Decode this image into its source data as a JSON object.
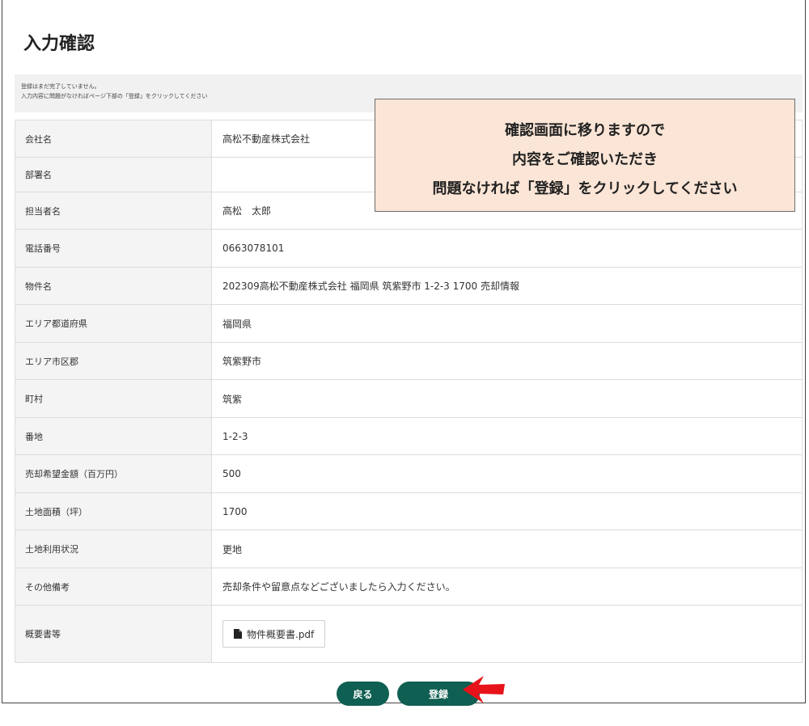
{
  "page": {
    "title": "入力確認",
    "notice_lines": [
      "登録はまだ完了していません。",
      "入力内容に問題がなければページ下部の「登録」をクリックしてください"
    ]
  },
  "form": {
    "rows": [
      {
        "label": "会社名",
        "value": "高松不動産株式会社"
      },
      {
        "label": "部署名",
        "value": ""
      },
      {
        "label": "担当者名",
        "value": "高松　太郎"
      },
      {
        "label": "電話番号",
        "value": "0663078101"
      },
      {
        "label": "物件名",
        "value": "202309高松不動産株式会社 福岡県 筑紫野市 1-2-3 1700 売却情報"
      },
      {
        "label": "エリア都道府県",
        "value": "福岡県"
      },
      {
        "label": "エリア市区郡",
        "value": "筑紫野市"
      },
      {
        "label": "町村",
        "value": "筑紫"
      },
      {
        "label": "番地",
        "value": "1-2-3"
      },
      {
        "label": "売却希望金額（百万円）",
        "value": "500"
      },
      {
        "label": "土地面積（坪）",
        "value": "1700"
      },
      {
        "label": "土地利用状況",
        "value": "更地"
      },
      {
        "label": "その他備考",
        "value": "売却条件や留意点などございましたら入力ください。"
      }
    ],
    "attachment": {
      "label": "概要書等",
      "file_name": "物件概要書.pdf",
      "icon": "file-icon"
    }
  },
  "buttons": {
    "back_label": "戻る",
    "register_label": "登録"
  },
  "callout": {
    "lines": [
      "確認画面に移りますので",
      "内容をご確認いただき",
      "問題なければ「登録」をクリックしてください"
    ]
  },
  "colors": {
    "button_bg": "#0f5f52",
    "callout_bg": "#fbe5d6",
    "arrow": "#e8121a",
    "label_bg": "#f4f4f4"
  }
}
